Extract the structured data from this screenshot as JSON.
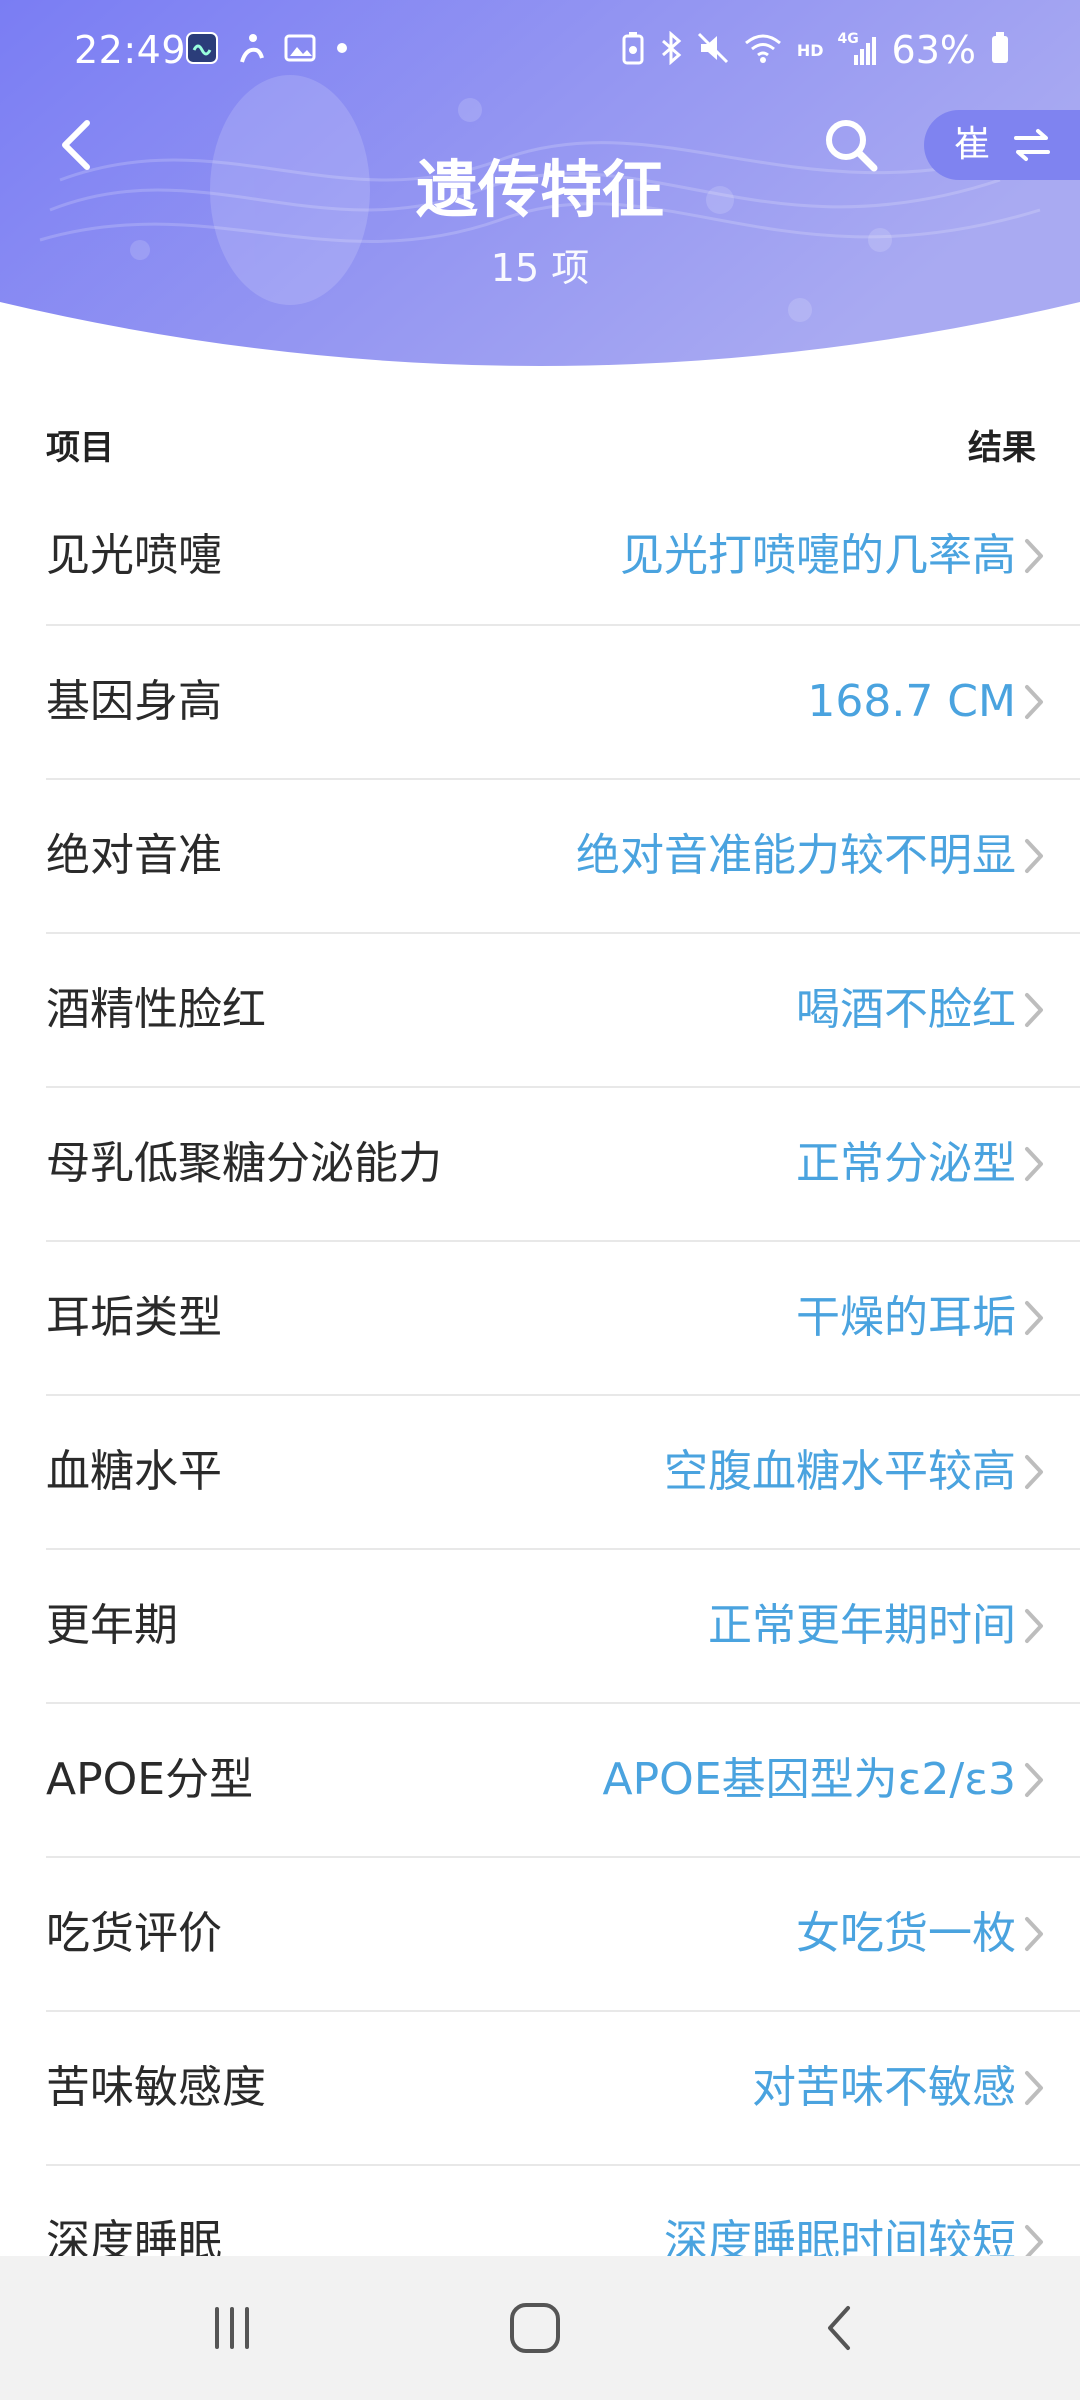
{
  "status_bar": {
    "time": "22:49",
    "battery_percent": "63%",
    "network_label": "4G",
    "hd_label": "HD",
    "left_icons": [
      "app-icon",
      "accessibility-icon",
      "gallery-icon",
      "dot-icon"
    ],
    "right_icons": [
      "battery-saver-icon",
      "bluetooth-icon",
      "mute-icon",
      "wifi-icon",
      "signal-icon",
      "battery-icon"
    ]
  },
  "header": {
    "title": "遗传特征",
    "subtitle": "15 项",
    "switch_name": "崔",
    "colors": {
      "gradient_start": "#7b7ef3",
      "gradient_end": "#a4a6f3",
      "pill": "#8084ef"
    }
  },
  "columns": {
    "left": "项目",
    "right": "结果"
  },
  "items": [
    {
      "label": "见光喷嚏",
      "value": "见光打喷嚏的几率高"
    },
    {
      "label": "基因身高",
      "value": "168.7 CM"
    },
    {
      "label": "绝对音准",
      "value": "绝对音准能力较不明显"
    },
    {
      "label": "酒精性脸红",
      "value": "喝酒不脸红"
    },
    {
      "label": "母乳低聚糖分泌能力",
      "value": "正常分泌型"
    },
    {
      "label": "耳垢类型",
      "value": "干燥的耳垢"
    },
    {
      "label": "血糖水平",
      "value": "空腹血糖水平较高"
    },
    {
      "label": "更年期",
      "value": "正常更年期时间"
    },
    {
      "label": "APOE分型",
      "value": "APOE基因型为ε2/ε3"
    },
    {
      "label": "吃货评价",
      "value": "女吃货一枚"
    },
    {
      "label": "苦味敏感度",
      "value": "对苦味不敏感"
    },
    {
      "label": "深度睡眠",
      "value": "深度睡眠时间较短"
    }
  ],
  "accent_value_color": "#4aa3df",
  "navbar": {
    "icons": [
      "recent-apps-icon",
      "home-icon",
      "back-nav-icon"
    ]
  }
}
